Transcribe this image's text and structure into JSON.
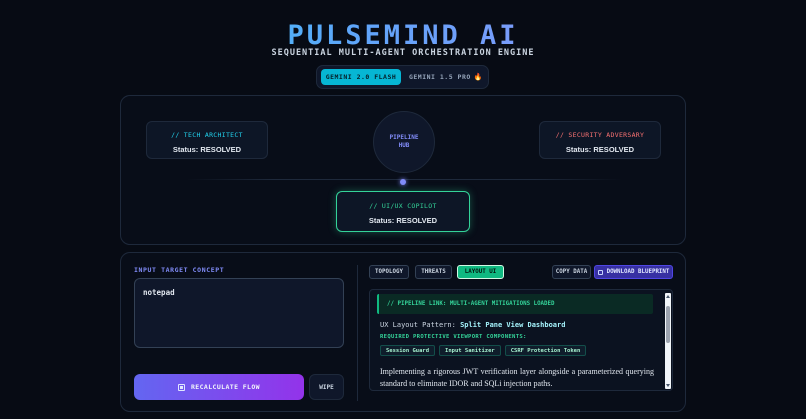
{
  "header": {
    "title": "PULSEMIND AI",
    "subtitle": "SEQUENTIAL MULTI-AGENT ORCHESTRATION ENGINE"
  },
  "model_switch": {
    "options": [
      {
        "label": "GEMINI 2.0 FLASH",
        "active": true
      },
      {
        "label": "GEMINI 1.5 PRO",
        "icon": "fire-icon",
        "active": false
      }
    ],
    "fire_glyph": "🔥"
  },
  "orchestration": {
    "hub": {
      "line1": "PIPELINE",
      "line2": "HUB"
    },
    "agents": {
      "tech": {
        "name": "// TECH ARCHITECT",
        "status": "Status: RESOLVED"
      },
      "security": {
        "name": "// SECURITY ADVERSARY",
        "status": "Status: RESOLVED"
      },
      "ux": {
        "name": "// UI/UX COPILOT",
        "status": "Status: RESOLVED"
      }
    }
  },
  "input": {
    "label": "INPUT TARGET CONCEPT",
    "value": "notepad"
  },
  "actions": {
    "recalculate": "RECALCULATE FLOW",
    "wipe": "WIPE"
  },
  "tabs": [
    {
      "label": "TOPOLOGY",
      "active": false
    },
    {
      "label": "THREATS",
      "active": false
    },
    {
      "label": "LAYOUT UI",
      "active": true
    }
  ],
  "toolbar": {
    "copy": "COPY DATA",
    "download": "DOWNLOAD BLUEPRINT"
  },
  "output": {
    "banner": "// PIPELINE LINK: MULTI-AGENT MITIGATIONS LOADED",
    "pattern_label": "UX Layout Pattern:",
    "pattern_value": "Split Pane View Dashboard",
    "required_label": "REQUIRED PROTECTIVE VIEWPORT COMPONENTS:",
    "components": [
      "Session Guard",
      "Input Sanitizer",
      "CSRF Protection Token"
    ],
    "description": "Implementing a rigorous JWT verification layer alongside a parameterized querying standard to eliminate IDOR and SQLi injection paths."
  },
  "colors": {
    "accent_cyan": "#06b6d4",
    "accent_green": "#10b981",
    "accent_indigo": "#818cf8",
    "danger_red": "#f87171",
    "background": "#070b14"
  }
}
